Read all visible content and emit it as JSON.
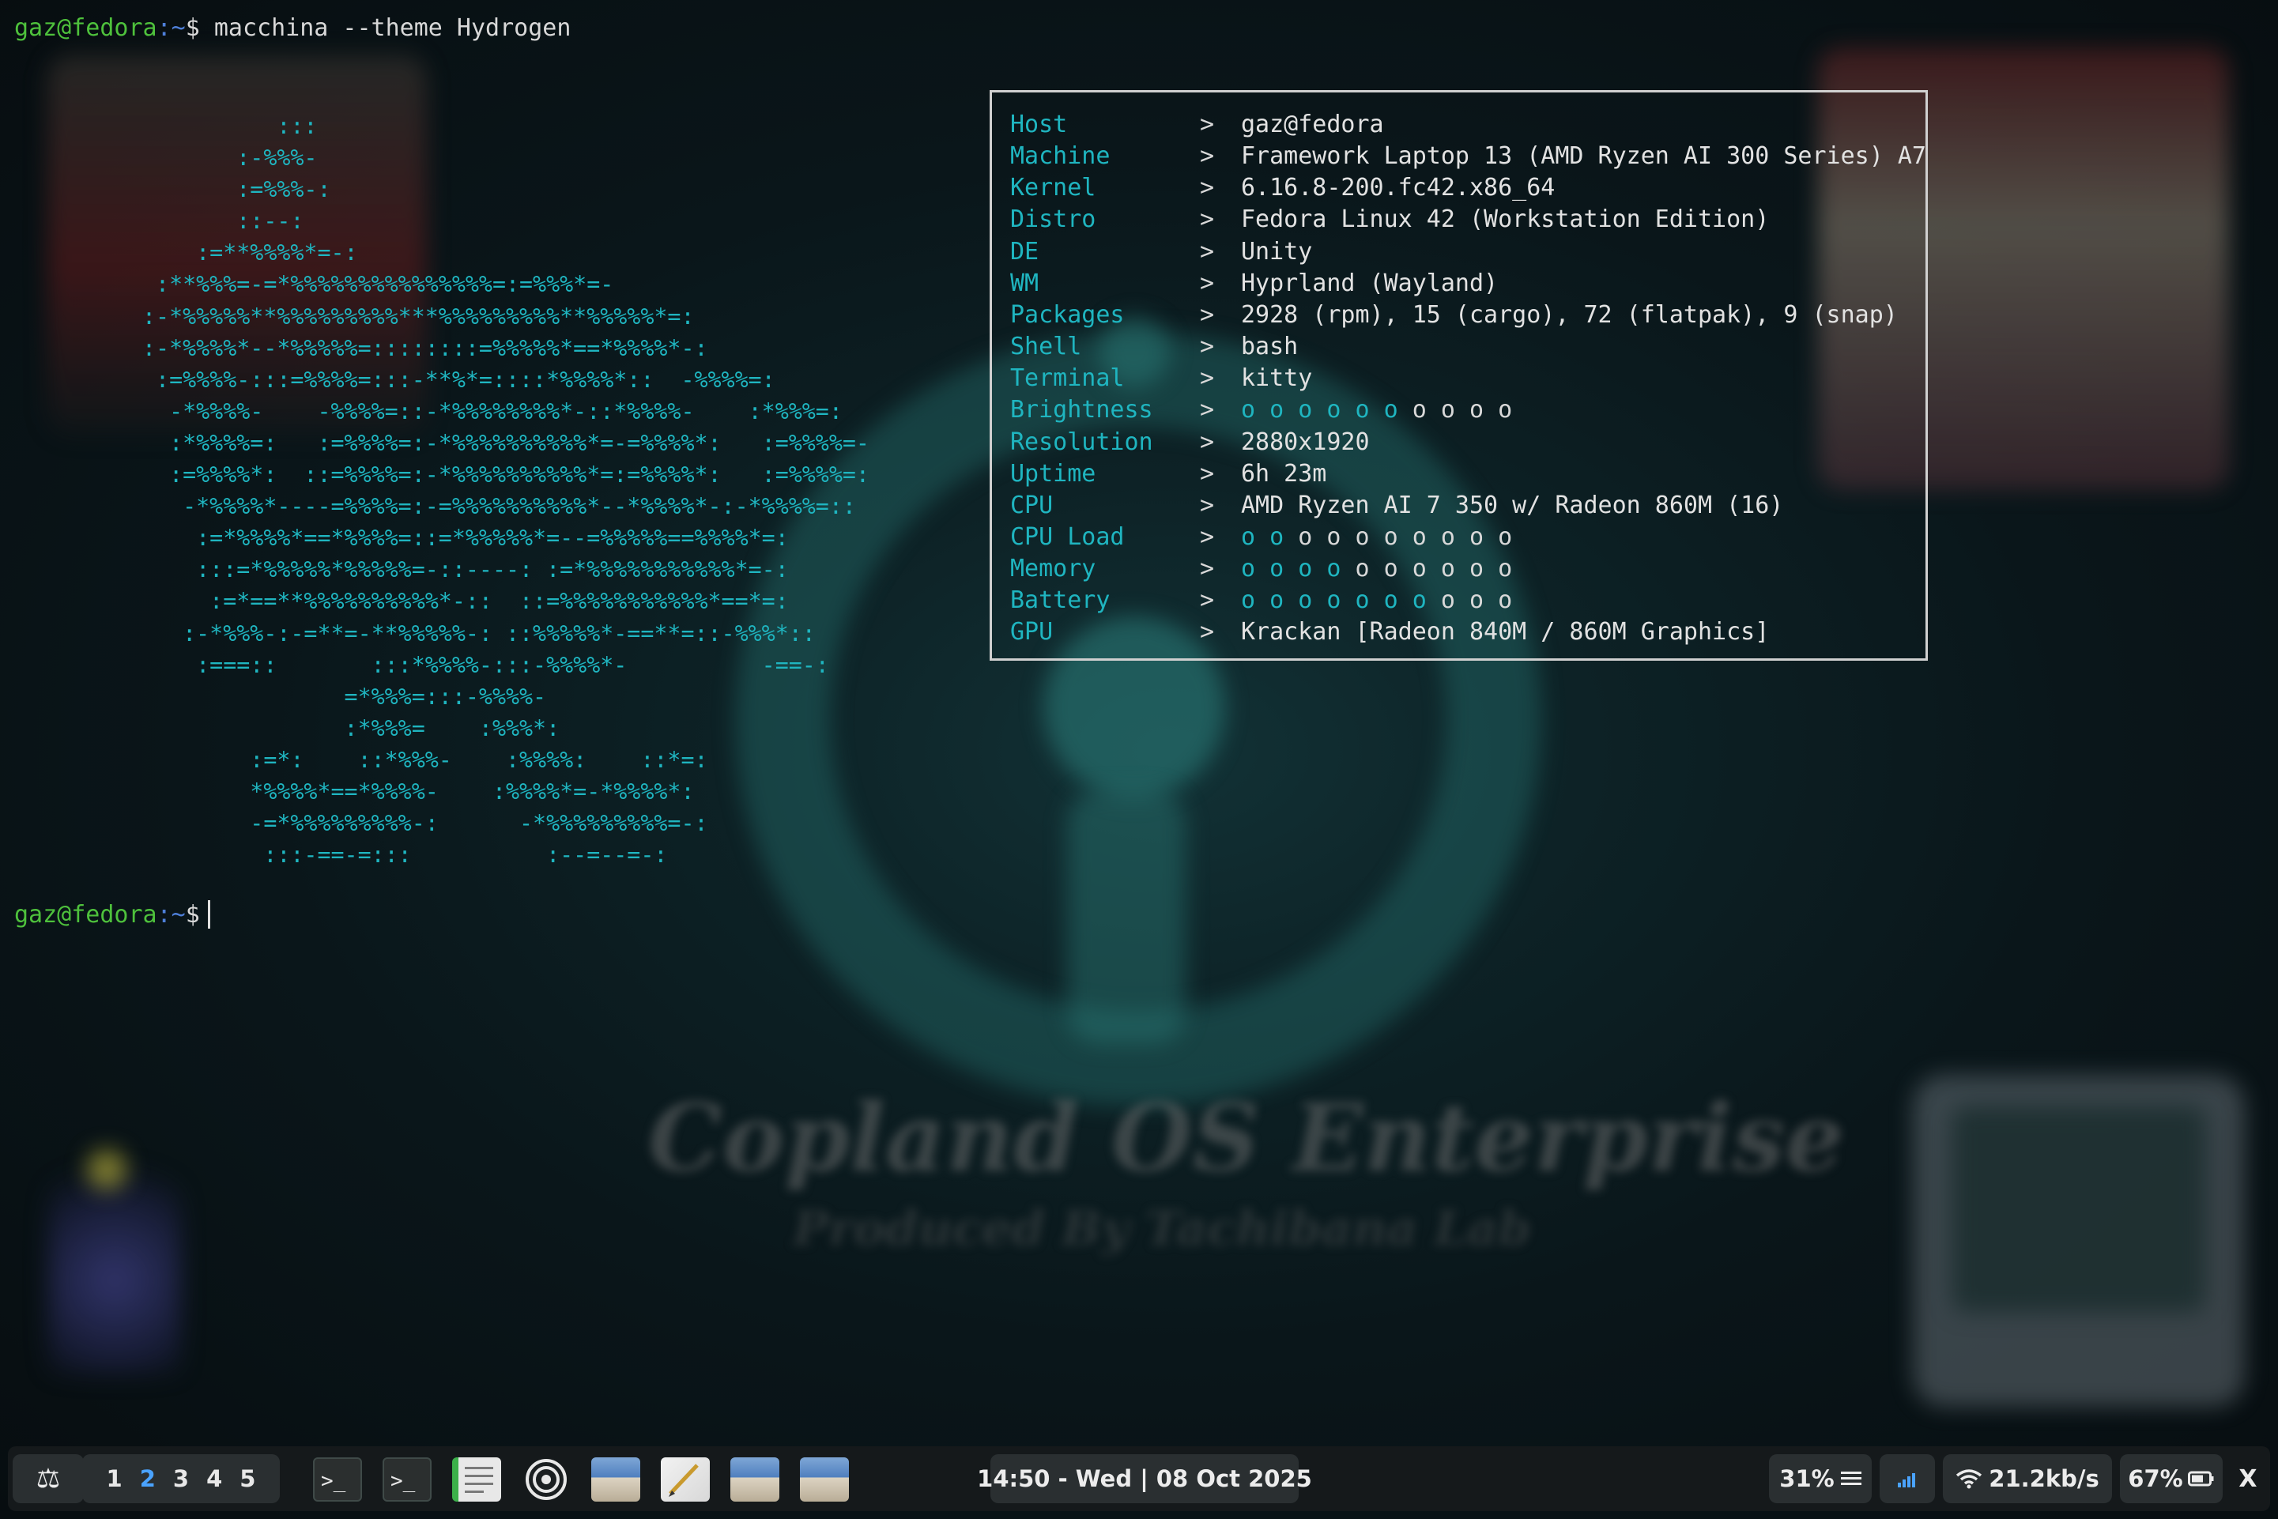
{
  "terminal": {
    "prompt_user": "gaz@fedora",
    "prompt_path": ":~",
    "prompt_symbol": "$",
    "command": "macchina --theme Hydrogen",
    "ascii_logo": "          :::\n       :-%%%-\n       :=%%%-:\n       ::--:\n    :=**%%%%*=-:\n :**%%%=-=*%%%%%%%%%%%%%%%=:=%%%*=-\n:-*%%%%%**%%%%%%%%%***%%%%%%%%%**%%%%%*=:\n:-*%%%%*--*%%%%%=::::::::=%%%%%*==*%%%%*-:\n :=%%%%-:::=%%%%=:::-**%*=::::*%%%%*::  -%%%%=:\n  -*%%%%-    -%%%%=::-*%%%%%%%%*-::*%%%%-    :*%%%=:\n  :*%%%%=:   :=%%%%=:-*%%%%%%%%%%*=-=%%%%*:   :=%%%%=-\n  :=%%%%*:  ::=%%%%=:-*%%%%%%%%%%*=:=%%%%*:   :=%%%%=:\n   -*%%%%*----=%%%%=:-=%%%%%%%%%%*--*%%%%*-:-*%%%%=::\n    :=*%%%%*==*%%%%=::=*%%%%%*=--=%%%%%==%%%%*=:\n    :::=*%%%%%*%%%%%=-::----: :=*%%%%%%%%%%%*=-:\n     :=*==**%%%%%%%%%%*-::  ::=%%%%%%%%%%%*==*=:\n   :-*%%%-:-=**=-**%%%%%-: ::%%%%%*-==**=::-%%%*::\n    :===::       :::*%%%%-:::-%%%%*-          -==-:\n               =*%%%=:::-%%%%-\n               :*%%%=    :%%%*:\n        :=*:    ::*%%%-    :%%%%:    ::*=:\n        *%%%%*==*%%%%-    :%%%%*=-*%%%%*:\n        -=*%%%%%%%%%-:      -*%%%%%%%%%=-:\n         :::-==-=:::          :--=--=-:",
    "prompt2_user": "gaz@fedora",
    "prompt2_path": ":~",
    "prompt2_symbol": "$"
  },
  "info": [
    {
      "key": "Host",
      "arrow": ">",
      "value": "gaz@fedora"
    },
    {
      "key": "Machine",
      "arrow": ">",
      "value": "Framework Laptop 13 (AMD Ryzen AI 300 Series) A7"
    },
    {
      "key": "Kernel",
      "arrow": ">",
      "value": "6.16.8-200.fc42.x86_64"
    },
    {
      "key": "Distro",
      "arrow": ">",
      "value": "Fedora Linux 42 (Workstation Edition)"
    },
    {
      "key": "DE",
      "arrow": ">",
      "value": "Unity"
    },
    {
      "key": "WM",
      "arrow": ">",
      "value": "Hyprland (Wayland)"
    },
    {
      "key": "Packages",
      "arrow": ">",
      "value": "2928 (rpm), 15 (cargo), 72 (flatpak), 9 (snap)"
    },
    {
      "key": "Shell",
      "arrow": ">",
      "value": "bash"
    },
    {
      "key": "Terminal",
      "arrow": ">",
      "value": "kitty"
    },
    {
      "key": "Brightness",
      "arrow": ">",
      "bar_filled": 6,
      "bar_total": 10
    },
    {
      "key": "Resolution",
      "arrow": ">",
      "value": "2880x1920"
    },
    {
      "key": "Uptime",
      "arrow": ">",
      "value": "6h 23m"
    },
    {
      "key": "CPU",
      "arrow": ">",
      "value": "AMD Ryzen AI 7 350 w/ Radeon 860M (16)"
    },
    {
      "key": "CPU Load",
      "arrow": ">",
      "bar_filled": 2,
      "bar_total": 10
    },
    {
      "key": "Memory",
      "arrow": ">",
      "bar_filled": 4,
      "bar_total": 10
    },
    {
      "key": "Battery",
      "arrow": ">",
      "bar_filled": 7,
      "bar_total": 10
    },
    {
      "key": "GPU",
      "arrow": ">",
      "value": "Krackan [Radeon 840M / 860M Graphics]"
    }
  ],
  "bar_glyph": "o",
  "wallpaper": {
    "title": "Copland OS Enterprise",
    "subtitle": "Produced By Tachibana Lab"
  },
  "panel": {
    "launcher_glyph": "⚖",
    "workspaces": [
      "1",
      "2",
      "3",
      "4",
      "5"
    ],
    "active_workspace": "2",
    "apps": [
      "terminal-icon",
      "terminal-icon",
      "text-editor-icon",
      "settings-icon",
      "file-manager-icon",
      "document-editor-icon",
      "file-manager-icon",
      "file-manager-icon"
    ],
    "clock": "14:50 - Wed | 08 Oct 2025",
    "cpu_percent": "31%",
    "network_speed": "21.2kb/s",
    "battery": "67%",
    "close_label": "X"
  },
  "colors": {
    "accent": "#1fb5c0",
    "prompt_user": "#4ec13c",
    "prompt_path": "#4e7fd8",
    "active_workspace": "#4aa3ff"
  }
}
